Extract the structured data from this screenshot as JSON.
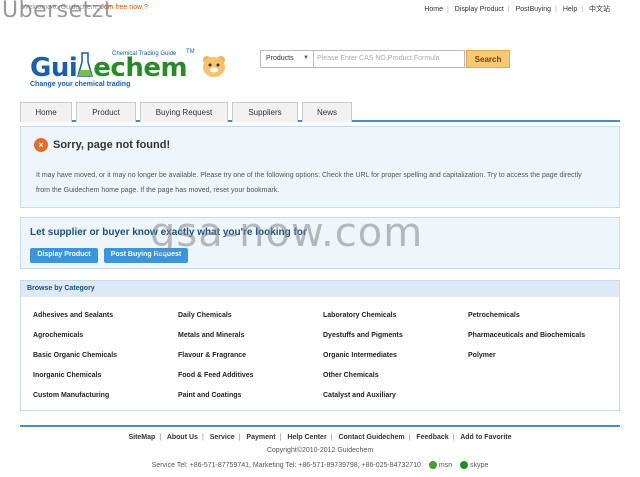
{
  "topbar": {
    "welcome": "Welcome to Guidechem,",
    "join": "Join free now ?",
    "overlay": "Übersetzt",
    "links": [
      "Home",
      "Display Product",
      "PostBuying",
      "Help",
      "中文站"
    ]
  },
  "logo": {
    "word_a": "Gui",
    "word_b": "d",
    "word_c": "e",
    "word_d": "chem",
    "sub": "Chemical Trading Guide",
    "tm": "TM",
    "tagline": "Change your chemical trading"
  },
  "search": {
    "select_value": "Products",
    "placeholder": "Please Enter CAS NO,Product,Formula",
    "button": "Search"
  },
  "nav": {
    "tabs": [
      "Home",
      "Product",
      "Buying Request",
      "Suppliers",
      "News"
    ]
  },
  "error": {
    "icon": "×",
    "title": "Sorry, page not found!",
    "body": "It may have moved, or it may no longer be available. Please try one of the following options: Check the URL for proper spelling and capitalization. Try to access the page directly from the Guidechem home page. If the page has moved, reset your bookmark."
  },
  "cta": {
    "title": "Let supplier or buyer know exactly what you're looking for",
    "btn_display": "Display Product",
    "btn_post": "Post Buying Request",
    "watermark": "gsa-now.com"
  },
  "categories": {
    "heading": "Browse by Category",
    "col1": [
      "Adhesives and Sealants",
      "Agrochemicals",
      "Basic Organic Chemicals",
      "Inorganic Chemicals",
      "Custom Manufacturing"
    ],
    "col2": [
      "Daily Chemicals",
      "Metals and Minerals",
      "Flavour & Fragrance",
      "Food & Feed Additives",
      "Paint and Coatings"
    ],
    "col3": [
      "Laboratory Chemicals",
      "Dyestuffs and Pigments",
      "Organic Intermediates",
      "Other Chemicals",
      "Catalyst and Auxiliary"
    ],
    "col4": [
      "Petrochemicals",
      "Pharmaceuticals and Biochemicals",
      "Polymer"
    ]
  },
  "footer": {
    "links": [
      "SiteMap",
      "About Us",
      "Service",
      "Payment",
      "Help Center",
      "Contact Guidechem",
      "Feedback",
      "Add to Favorite"
    ],
    "copyright": "Copyright©2010-2012 Guidechem",
    "contact": "Service Tel: +86-571-87759741, Marketing Tel: +86-571-89739798, +86-025-84732710",
    "msn": "msn",
    "skype": "skype"
  }
}
